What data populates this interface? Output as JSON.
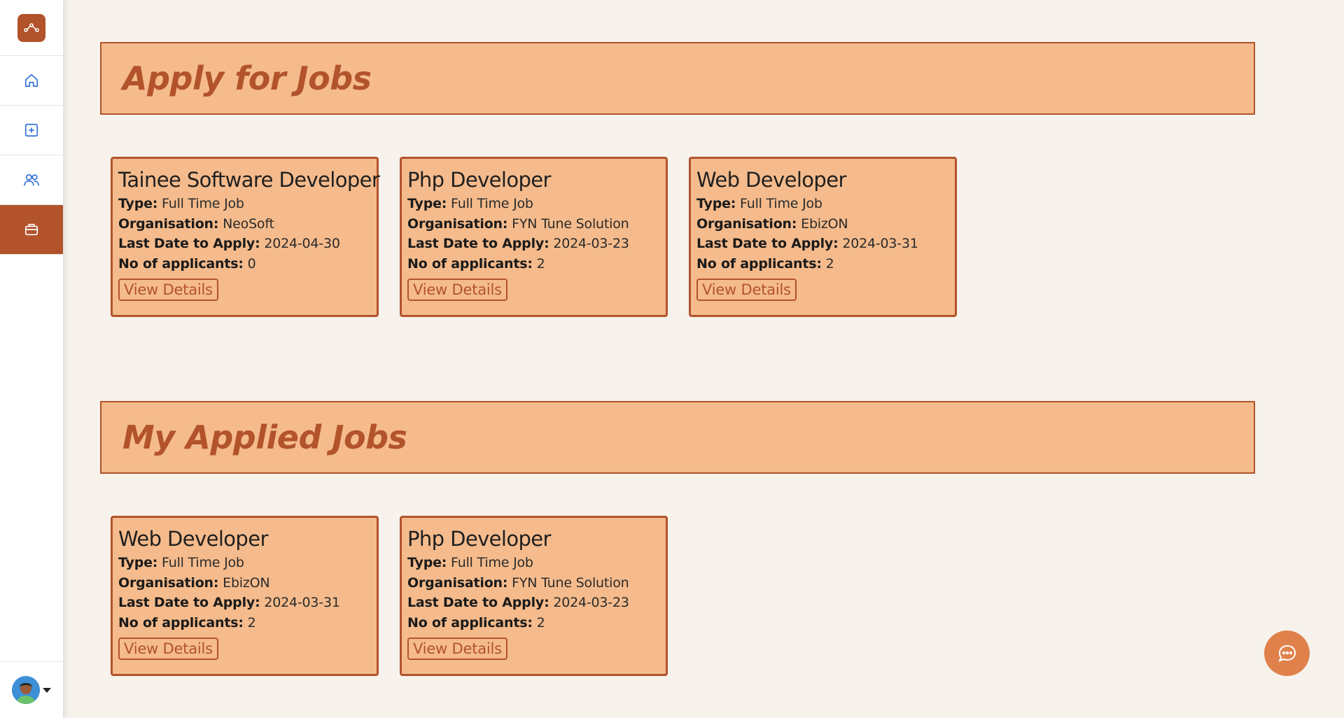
{
  "colors": {
    "accent": "#b2532b",
    "card_bg": "#f5bb8c",
    "page_bg": "#f7f2ec",
    "chat_button": "#e0814b"
  },
  "sidebar": {
    "logo_icon": "route-icon",
    "items": [
      {
        "icon": "home-icon",
        "active": false
      },
      {
        "icon": "add-square-icon",
        "active": false
      },
      {
        "icon": "users-icon",
        "active": false
      },
      {
        "icon": "briefcase-icon",
        "active": true
      }
    ],
    "profile": {
      "icon": "avatar",
      "dropdown_icon": "caret-down-icon"
    }
  },
  "apply_section": {
    "title": "Apply for Jobs",
    "jobs": [
      {
        "title": "Tainee Software Developer",
        "type_label": "Type:",
        "type": "Full Time Job",
        "org_label": "Organisation:",
        "org": "NeoSoft",
        "date_label": "Last Date to Apply:",
        "date": "2024-04-30",
        "applicants_label": "No of applicants:",
        "applicants": "0",
        "button": "View Details"
      },
      {
        "title": "Php Developer",
        "type_label": "Type:",
        "type": "Full Time Job",
        "org_label": "Organisation:",
        "org": "FYN Tune Solution",
        "date_label": "Last Date to Apply:",
        "date": "2024-03-23",
        "applicants_label": "No of applicants:",
        "applicants": "2",
        "button": "View Details"
      },
      {
        "title": "Web Developer",
        "type_label": "Type:",
        "type": "Full Time Job",
        "org_label": "Organisation:",
        "org": "EbizON",
        "date_label": "Last Date to Apply:",
        "date": "2024-03-31",
        "applicants_label": "No of applicants:",
        "applicants": "2",
        "button": "View Details"
      }
    ]
  },
  "applied_section": {
    "title": "My Applied Jobs",
    "jobs": [
      {
        "title": "Web Developer",
        "type_label": "Type:",
        "type": "Full Time Job",
        "org_label": "Organisation:",
        "org": "EbizON",
        "date_label": "Last Date to Apply:",
        "date": "2024-03-31",
        "applicants_label": "No of applicants:",
        "applicants": "2",
        "button": "View Details"
      },
      {
        "title": "Php Developer",
        "type_label": "Type:",
        "type": "Full Time Job",
        "org_label": "Organisation:",
        "org": "FYN Tune Solution",
        "date_label": "Last Date to Apply:",
        "date": "2024-03-23",
        "applicants_label": "No of applicants:",
        "applicants": "2",
        "button": "View Details"
      }
    ]
  },
  "chat": {
    "icon": "chat-bubble-icon"
  }
}
